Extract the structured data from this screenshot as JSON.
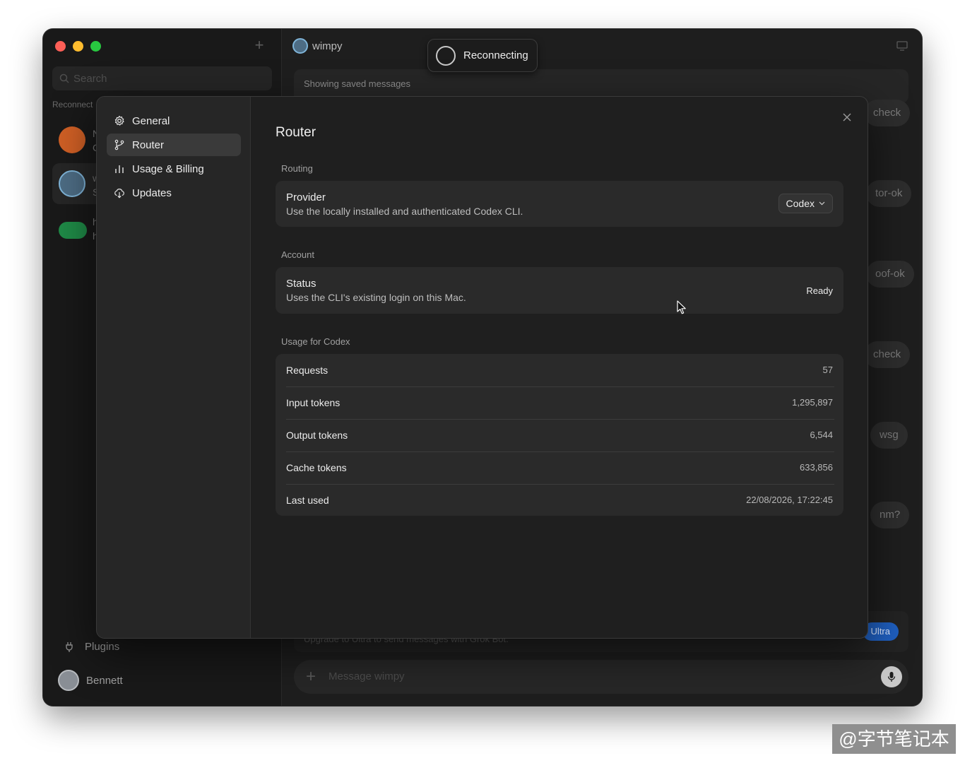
{
  "sidebar": {
    "search_placeholder": "Search",
    "section_label": "Reconnect",
    "conv_fragments": [
      "N",
      "C",
      "w",
      "S",
      "h",
      "h"
    ],
    "plugins_label": "Plugins",
    "user_name": "Bennett"
  },
  "chat": {
    "title": "wimpy",
    "reconnecting": "Reconnecting",
    "banner": "Showing saved messages",
    "pills": [
      "check",
      "tor-ok",
      "oof-ok",
      "check",
      "wsg",
      "nm?"
    ],
    "upgrade_text": "Upgrade to Ultra to send messages with Grok Bot.",
    "upgrade_button": "Ultra",
    "composer_placeholder": "Message wimpy"
  },
  "settings": {
    "nav": [
      {
        "label": "General",
        "icon": "gear-icon"
      },
      {
        "label": "Router",
        "icon": "git-branch-icon"
      },
      {
        "label": "Usage & Billing",
        "icon": "bar-chart-icon"
      },
      {
        "label": "Updates",
        "icon": "cloud-download-icon"
      }
    ],
    "active_nav": "Router",
    "title": "Router",
    "routing": {
      "label": "Routing",
      "provider_title": "Provider",
      "provider_desc": "Use the locally installed and authenticated Codex CLI.",
      "provider_value": "Codex"
    },
    "account": {
      "label": "Account",
      "status_title": "Status",
      "status_desc": "Uses the CLI's existing login on this Mac.",
      "status_value": "Ready"
    },
    "usage": {
      "label": "Usage for Codex",
      "rows": [
        {
          "key": "Requests",
          "value": "57"
        },
        {
          "key": "Input tokens",
          "value": "1,295,897"
        },
        {
          "key": "Output tokens",
          "value": "6,544"
        },
        {
          "key": "Cache tokens",
          "value": "633,856"
        },
        {
          "key": "Last used",
          "value": "22/08/2026, 17:22:45"
        }
      ]
    }
  },
  "watermark": "@字节笔记本",
  "colors": {
    "traffic_red": "#fe5f57",
    "traffic_yellow": "#febc2e",
    "traffic_green": "#28c840",
    "accent_blue": "#1f5fbf",
    "window_bg": "#1e1e1e",
    "card_bg": "#2a2a2a"
  }
}
